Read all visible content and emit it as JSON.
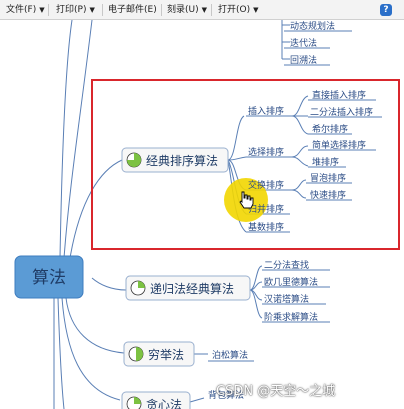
{
  "menubar": {
    "items": [
      {
        "label": "文件(F)"
      },
      {
        "label": "打印(P)"
      },
      {
        "label": "电子邮件(E)"
      },
      {
        "label": "刻录(U)"
      },
      {
        "label": "打开(O)"
      }
    ],
    "help_label": "?"
  },
  "mindmap": {
    "root": "算法",
    "top_partial": [
      "动态规划法",
      "迭代法",
      "回溯法"
    ],
    "classic_sort": {
      "label": "经典排序算法",
      "insertion": {
        "label": "插入排序",
        "items": [
          "直接插入排序",
          "二分法插入排序",
          "希尔排序"
        ]
      },
      "selection": {
        "label": "选择排序",
        "items": [
          "简单选择排序",
          "堆排序"
        ]
      },
      "exchange": {
        "label": "交换排序",
        "items": [
          "冒泡排序",
          "快速排序"
        ]
      },
      "merge": "归并排序",
      "radix": "基数排序"
    },
    "recursion": {
      "label": "递归法经典算法",
      "items": [
        "二分法查找",
        "欧几里德算法",
        "汉诺塔算法",
        "阶乘求解算法"
      ]
    },
    "enumeration": {
      "label": "穷举法",
      "items": [
        "泊松算法"
      ]
    },
    "greedy": {
      "label": "贪心法",
      "items": [
        "背包算法"
      ]
    }
  },
  "watermark": "CSDN @天空～之城",
  "colors": {
    "highlight_border": "#d9262c",
    "cursor_highlight": "#f2d600",
    "root_fill": "#5b9bd5",
    "line": "#5a7fb5"
  }
}
